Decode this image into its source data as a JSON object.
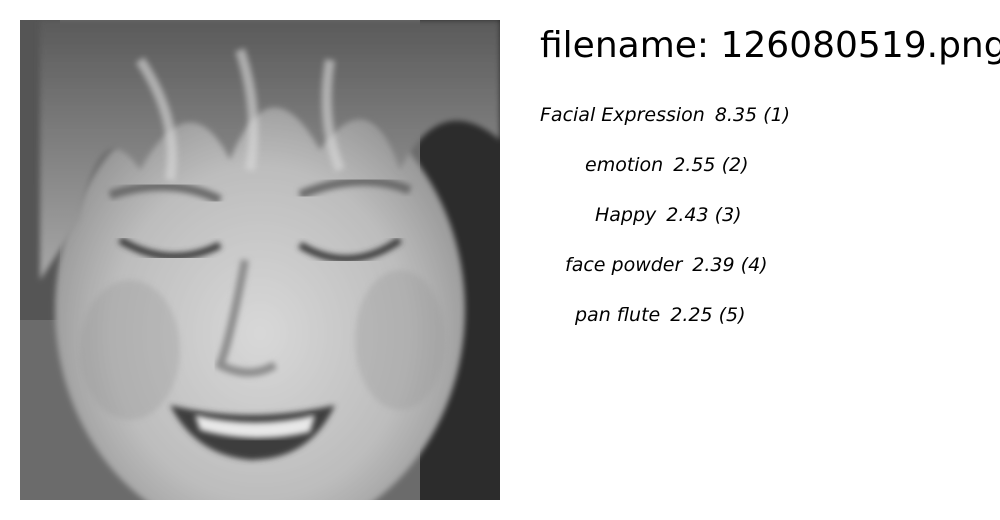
{
  "filename_label": "filename: 126080519.png",
  "image": {
    "subject": "grayscale close-up of a smiling face with bangs, eyes looking down"
  },
  "predictions": [
    {
      "label": "Facial Expression",
      "score": "8.35",
      "rank": "(1)"
    },
    {
      "label": "emotion",
      "score": "2.55",
      "rank": "(2)"
    },
    {
      "label": "Happy",
      "score": "2.43",
      "rank": "(3)"
    },
    {
      "label": "face powder",
      "score": "2.39",
      "rank": "(4)"
    },
    {
      "label": "pan flute",
      "score": "2.25",
      "rank": "(5)"
    }
  ]
}
